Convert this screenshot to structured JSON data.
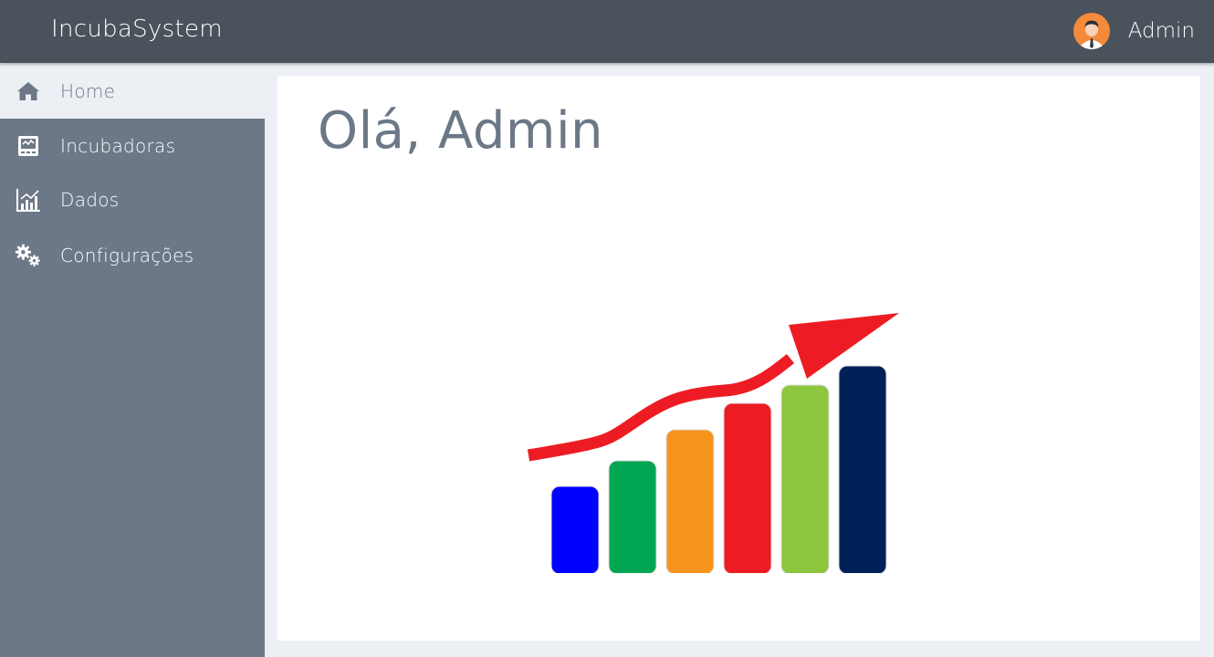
{
  "header": {
    "brand": "IncubaSystem",
    "user_name": "Admin"
  },
  "sidebar": {
    "items": [
      {
        "label": "Home",
        "icon": "home-icon",
        "active": true
      },
      {
        "label": "Incubadoras",
        "icon": "incubator-icon",
        "active": false
      },
      {
        "label": "Dados",
        "icon": "chart-icon",
        "active": false
      },
      {
        "label": "Configurações",
        "icon": "gears-icon",
        "active": false
      }
    ]
  },
  "main": {
    "greeting": "Olá, Admin",
    "illustration": "growth-chart-illustration"
  },
  "colors": {
    "topbar": "#4a525c",
    "sidebar": "#6c7887",
    "background": "#eceff3",
    "arrow": "#ed1c24",
    "bars": [
      "#0000ff",
      "#00a651",
      "#f7941d",
      "#ed1c24",
      "#8dc63f",
      "#002157"
    ]
  }
}
